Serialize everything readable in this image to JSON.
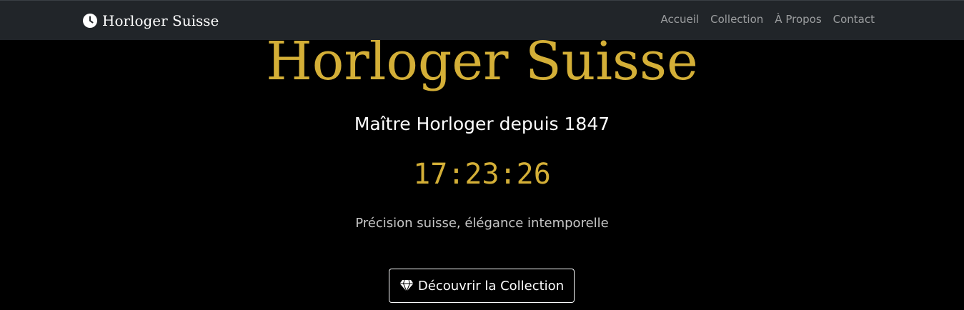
{
  "navbar": {
    "brand_icon": "clock-icon",
    "brand": "Horloger Suisse",
    "links": [
      "Accueil",
      "Collection",
      "À Propos",
      "Contact"
    ]
  },
  "hero": {
    "title": "Horloger Suisse",
    "subtitle": "Maître Horloger depuis 1847",
    "clock": "17:23:26",
    "tagline": "Précision suisse, élégance intemporelle",
    "cta_icon": "gem-icon",
    "cta_label": "Découvrir la Collection"
  },
  "colors": {
    "accent_gold": "#d4af37",
    "navbar_bg": "#212529",
    "page_bg": "#000000"
  }
}
